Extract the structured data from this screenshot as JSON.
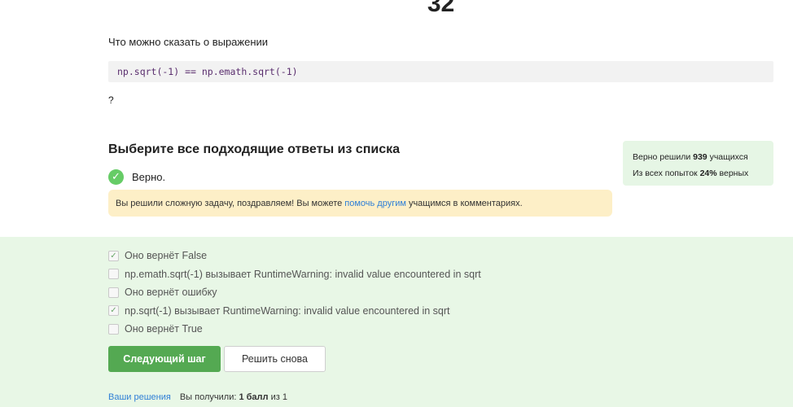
{
  "step": {
    "number": "32"
  },
  "question": {
    "text": "Что можно сказать о выражении",
    "code": "np.sqrt(-1) == np.emath.sqrt(-1)",
    "suffix": "?"
  },
  "answers": {
    "heading": "Выберите все подходящие ответы из списка",
    "verdict": "Верно.",
    "congrats_before": "Вы решили сложную задачу, поздравляем! Вы можете",
    "congrats_link": "помочь другим",
    "congrats_after": "учащимся в комментариях."
  },
  "stats": {
    "line1_prefix": "Верно решили",
    "solved_count": "939",
    "line1_suffix": "учащихся",
    "line2_prefix": "Из всех попыток",
    "percent": "24%",
    "line2_suffix": "верных"
  },
  "options": [
    {
      "label": "Оно вернёт False",
      "checked": true
    },
    {
      "label": "np.emath.sqrt(-1) вызывает RuntimeWarning: invalid value encountered in sqrt",
      "checked": false
    },
    {
      "label": "Оно вернёт ошибку",
      "checked": false
    },
    {
      "label": "np.sqrt(-1) вызывает RuntimeWarning: invalid value encountered in sqrt",
      "checked": true
    },
    {
      "label": "Оно вернёт True",
      "checked": false
    }
  ],
  "buttons": {
    "next": "Следующий шаг",
    "retry": "Решить снова"
  },
  "footer": {
    "solutions_link": "Ваши решения",
    "got_prefix": "Вы получили:",
    "score": "1 балл",
    "of": "из",
    "max": "1"
  },
  "colors": {
    "accent_green": "#54a952",
    "link_blue": "#2f7fd6",
    "success_bg": "#e8f7e6",
    "notice_bg": "#fdefc7"
  }
}
